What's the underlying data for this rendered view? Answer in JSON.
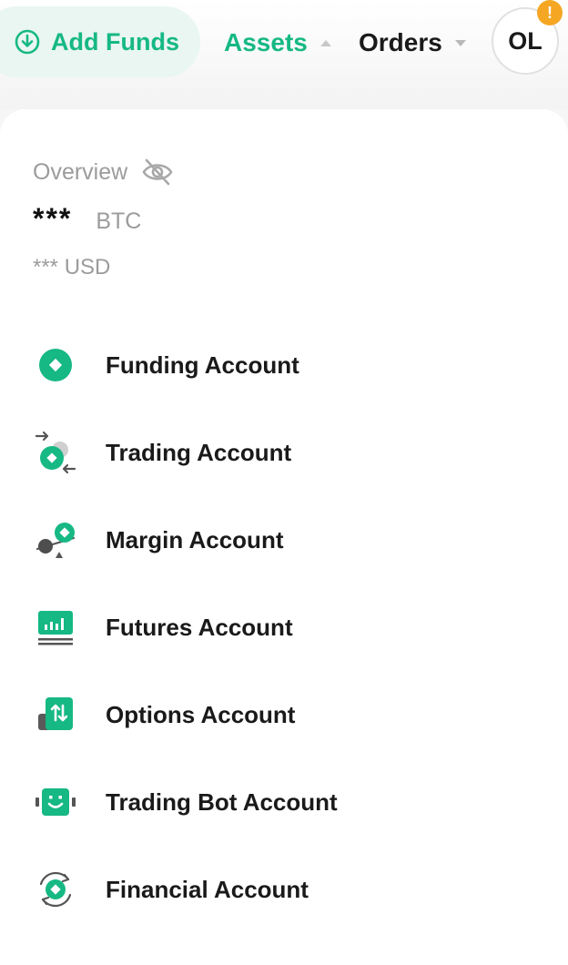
{
  "header": {
    "add_funds_label": "Add Funds",
    "assets_label": "Assets",
    "orders_label": "Orders",
    "avatar_initials": "OL",
    "alert_glyph": "!"
  },
  "overview": {
    "label": "Overview",
    "btc_value": "***",
    "btc_unit": "BTC",
    "usd_value": "*** USD"
  },
  "accounts": [
    {
      "label": "Funding Account",
      "icon": "funding-icon"
    },
    {
      "label": "Trading Account",
      "icon": "trading-icon"
    },
    {
      "label": "Margin Account",
      "icon": "margin-icon"
    },
    {
      "label": "Futures Account",
      "icon": "futures-icon"
    },
    {
      "label": "Options Account",
      "icon": "options-icon"
    },
    {
      "label": "Trading Bot Account",
      "icon": "trading-bot-icon"
    },
    {
      "label": "Financial Account",
      "icon": "financial-icon"
    }
  ],
  "colors": {
    "accent": "#16b884",
    "accent_light": "#e9f6f1",
    "muted": "#9c9c9c",
    "badge": "#f5a623"
  }
}
